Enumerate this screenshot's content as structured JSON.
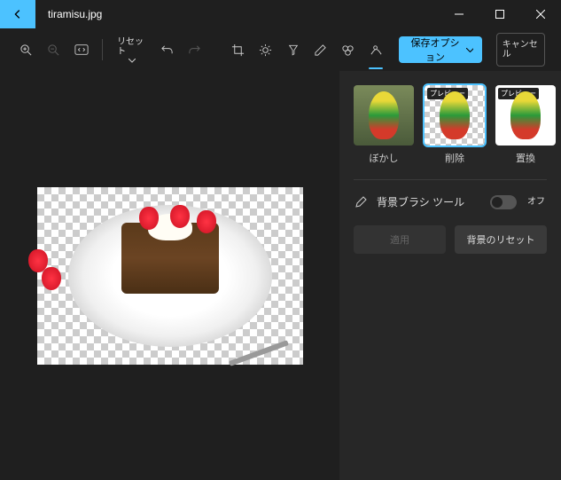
{
  "titlebar": {
    "filename": "tiramisu.jpg"
  },
  "toolbar": {
    "reset_label": "リセット",
    "save_label": "保存オプション",
    "cancel_label": "キャンセル"
  },
  "panel": {
    "preview_badge": "プレビュー",
    "thumbs": [
      {
        "label": "ぼかし"
      },
      {
        "label": "削除"
      },
      {
        "label": "置換"
      }
    ],
    "brush_label": "背景ブラシ ツール",
    "toggle_label": "オフ",
    "apply_label": "適用",
    "reset_bg_label": "背景のリセット"
  }
}
